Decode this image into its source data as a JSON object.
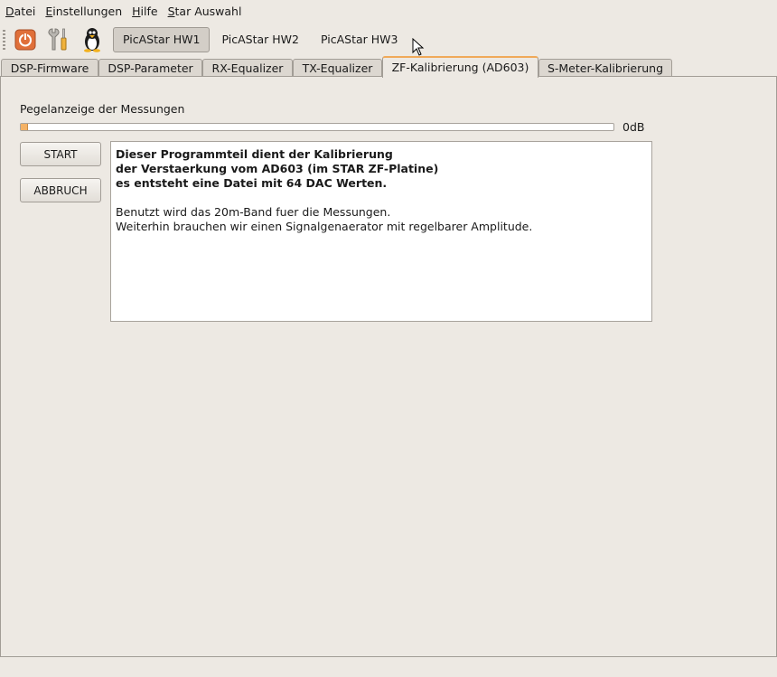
{
  "menubar": {
    "items": [
      {
        "accel": "D",
        "rest": "atei"
      },
      {
        "accel": "E",
        "rest": "instellungen"
      },
      {
        "accel": "H",
        "rest": "ilfe"
      },
      {
        "accel": "S",
        "rest": "tar Auswahl"
      }
    ]
  },
  "toolbar": {
    "icons": [
      "power-icon",
      "tools-icon",
      "tux-penguin-icon"
    ],
    "hw_buttons": [
      "PicAStar HW1",
      "PicAStar HW2",
      "PicAStar HW3"
    ],
    "active_hw": "PicAStar HW1",
    "accent_power": "#e0703a"
  },
  "tabs": {
    "items": [
      "DSP-Firmware",
      "DSP-Parameter",
      "RX-Equalizer",
      "TX-Equalizer",
      "ZF-Kalibrierung (AD603)",
      "S-Meter-Kalibrierung"
    ],
    "active": "ZF-Kalibrierung (AD603)",
    "accent": "#f0a95a"
  },
  "measurement": {
    "label": "Pegelanzeige der Messungen",
    "level_fraction": 0.01,
    "readout": "0dB"
  },
  "buttons": {
    "start": "START",
    "abort": "ABBRUCH"
  },
  "info_text": {
    "bold_lines": [
      "Dieser Programmteil dient der Kalibrierung",
      "der Verstaerkung vom AD603 (im STAR ZF-Platine)",
      "es entsteht eine Datei mit 64 DAC Werten."
    ],
    "lines": [
      "Benutzt wird das 20m-Band fuer die Messungen.",
      "Weiterhin brauchen wir einen Signalgenaerator mit regelbarer Amplitude."
    ]
  }
}
